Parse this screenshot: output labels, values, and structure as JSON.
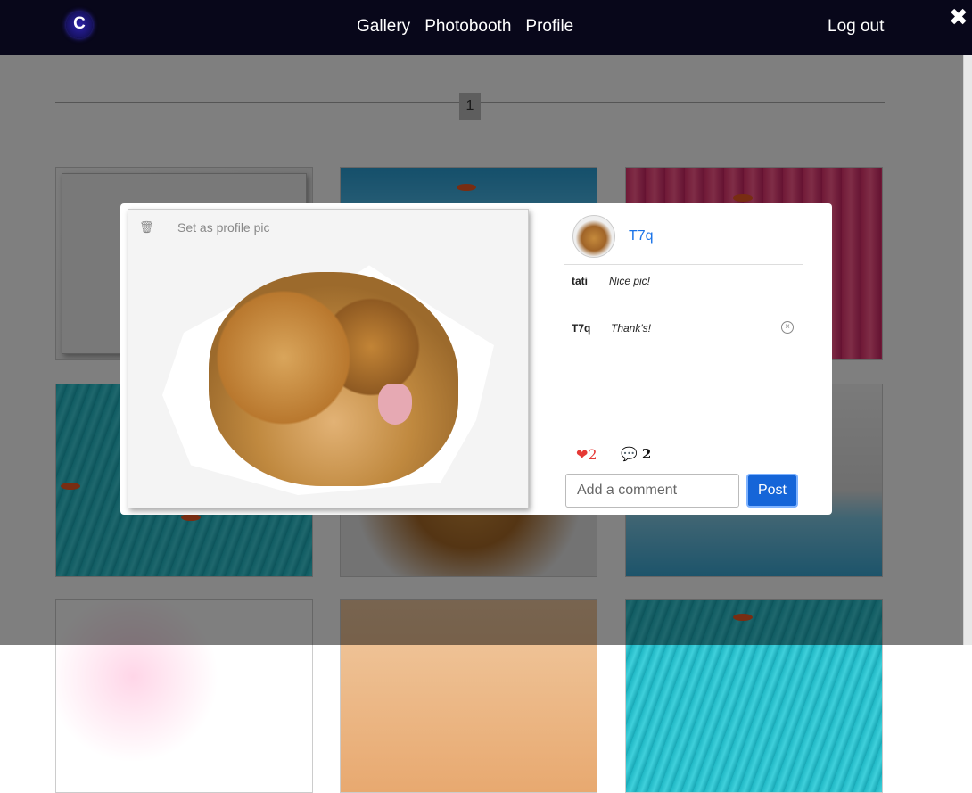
{
  "nav": {
    "logo_letter": "C",
    "links": [
      "Gallery",
      "Photobooth",
      "Profile"
    ],
    "logout": "Log out",
    "close_symbol": "✖"
  },
  "gallery": {
    "page_number": "1"
  },
  "modal": {
    "set_profile_pic": "Set as profile pic",
    "author": "T7q",
    "comments": [
      {
        "user": "tati",
        "text": "Nice pic!"
      },
      {
        "user": "T7q",
        "text": "Thank's!"
      }
    ],
    "like_count": "2",
    "comment_count": "2",
    "comment_placeholder": "Add a comment",
    "post_label": "Post"
  },
  "colors": {
    "nav_bg": "#08071a",
    "link_color": "#1a73e8",
    "post_button": "#1565d8",
    "heart": "#e53935"
  }
}
